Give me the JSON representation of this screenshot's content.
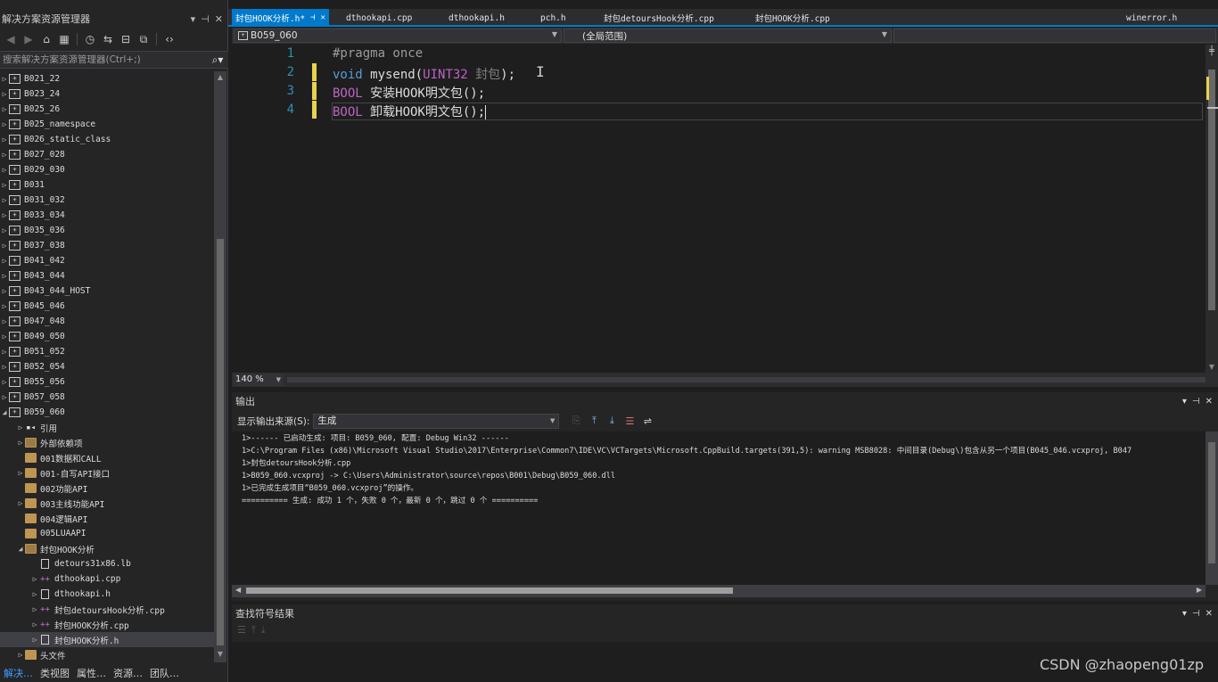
{
  "solution_explorer": {
    "title": "解决方案资源管理器",
    "search_placeholder": "搜索解决方案资源管理器(Ctrl+;)",
    "items": [
      {
        "label": "B021_22"
      },
      {
        "label": "B023_24"
      },
      {
        "label": "B025_26"
      },
      {
        "label": "B025_namespace"
      },
      {
        "label": "B026_static_class"
      },
      {
        "label": "B027_028"
      },
      {
        "label": "B029_030"
      },
      {
        "label": "B031"
      },
      {
        "label": "B031_032"
      },
      {
        "label": "B033_034"
      },
      {
        "label": "B035_036"
      },
      {
        "label": "B037_038"
      },
      {
        "label": "B041_042"
      },
      {
        "label": "B043_044"
      },
      {
        "label": "B043_044_HOST"
      },
      {
        "label": "B045_046"
      },
      {
        "label": "B047_048"
      },
      {
        "label": "B049_050"
      },
      {
        "label": "B051_052"
      },
      {
        "label": "B052_054"
      },
      {
        "label": "B055_056"
      },
      {
        "label": "B057_058"
      },
      {
        "label": "B059_060"
      },
      {
        "label": "引用"
      },
      {
        "label": "外部依赖项"
      },
      {
        "label": "001数据和CALL"
      },
      {
        "label": "001-自写API接口"
      },
      {
        "label": "002功能API"
      },
      {
        "label": "003主线功能API"
      },
      {
        "label": "004逻辑API"
      },
      {
        "label": "005LUAAPI"
      },
      {
        "label": "封包HOOK分析"
      },
      {
        "label": "detours31x86.lb"
      },
      {
        "label": "dthookapi.cpp"
      },
      {
        "label": "dthookapi.h"
      },
      {
        "label": "封包detoursHook分析.cpp"
      },
      {
        "label": "封包HOOK分析.cpp"
      },
      {
        "label": "封包HOOK分析.h"
      },
      {
        "label": "头文件"
      }
    ],
    "bottom_tabs": [
      "解决…",
      "类视图",
      "属性…",
      "资源…",
      "团队…"
    ]
  },
  "tabs": [
    {
      "label": "封包HOOK分析.h*"
    },
    {
      "label": "dthookapi.cpp"
    },
    {
      "label": "dthookapi.h"
    },
    {
      "label": "pch.h"
    },
    {
      "label": "封包detoursHook分析.cpp"
    },
    {
      "label": "封包HOOK分析.cpp"
    },
    {
      "label": "winerror.h"
    }
  ],
  "navbar": {
    "project": "B059_060",
    "scope": "(全局范围)"
  },
  "editor": {
    "line_numbers": [
      "1",
      "2",
      "3",
      "4"
    ],
    "line1": "#pragma once",
    "line2": {
      "kw": "void",
      "name": " mysend(",
      "type": "UINT32",
      "param": " 封包",
      "end": ");"
    },
    "line3": {
      "macro": "BOOL",
      "rest": " 安装HOOK明文包();"
    },
    "line4": {
      "macro": "BOOL",
      "rest": " 卸载HOOK明文包();"
    },
    "zoom": "140 %"
  },
  "output": {
    "title": "输出",
    "source_label": "显示输出来源(S):",
    "source_value": "生成",
    "lines": [
      "1>------ 已启动生成: 项目: B059_060, 配置: Debug Win32 ------",
      "1>C:\\Program Files (x86)\\Microsoft Visual Studio\\2017\\Enterprise\\Common7\\IDE\\VC\\VCTargets\\Microsoft.CppBuild.targets(391,5): warning MSB8028: 中间目录(Debug\\)包含从另一个项目(B045_046.vcxproj, B047",
      "1>封包detoursHook分析.cpp",
      "1>B059_060.vcxproj -> C:\\Users\\Administrator\\source\\repos\\B001\\Debug\\B059_060.dll",
      "1>已完成生成项目“B059_060.vcxproj”的操作。",
      "========== 生成: 成功 1 个，失败 0 个，最新 0 个，跳过 0 个 =========="
    ]
  },
  "find_symbol": {
    "title": "查找符号结果"
  },
  "watermark": "CSDN @zhaopeng01zp"
}
